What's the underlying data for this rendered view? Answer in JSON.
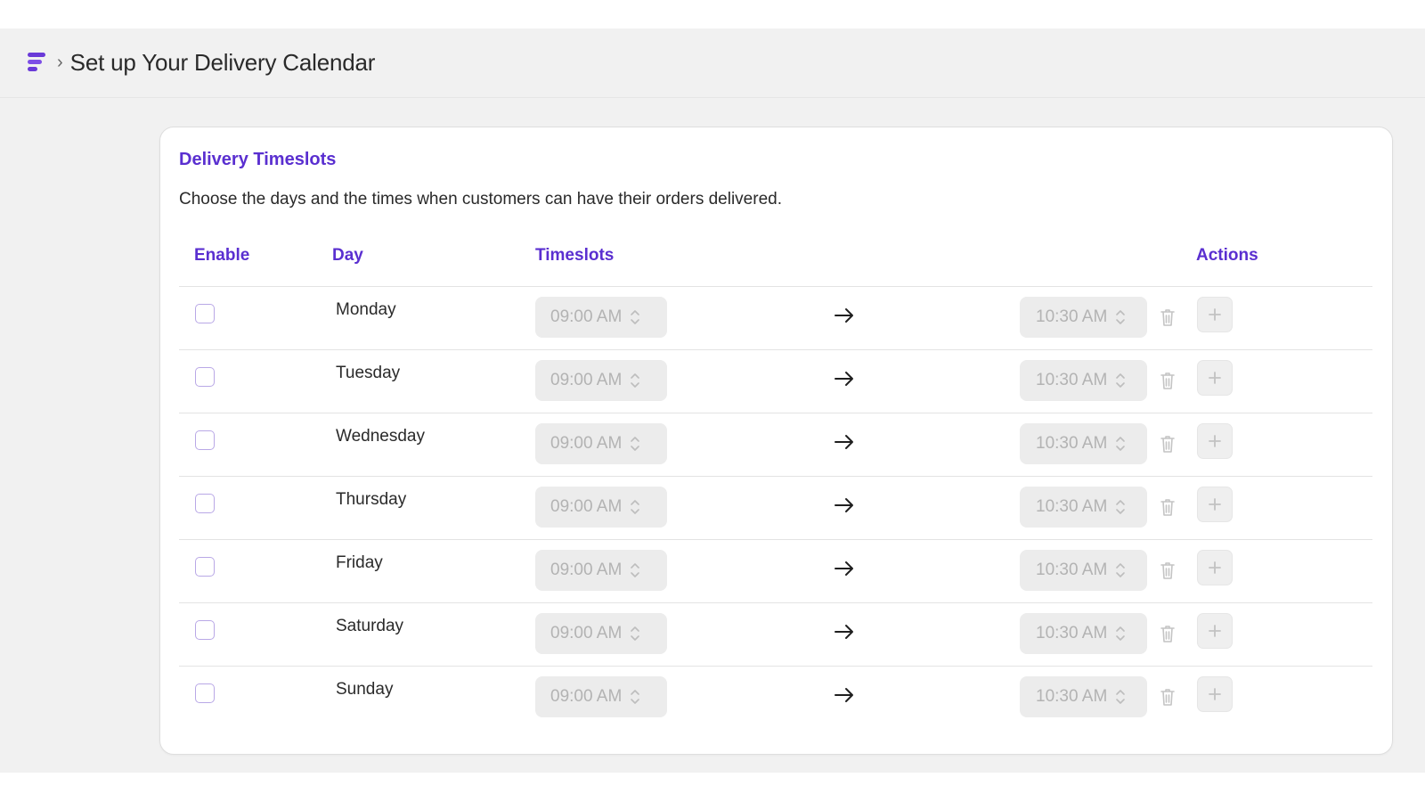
{
  "header": {
    "breadcrumb_separator": "›",
    "title": "Set up Your Delivery Calendar"
  },
  "card": {
    "title": "Delivery Timeslots",
    "description": "Choose the days and the times when customers can have their orders delivered."
  },
  "table": {
    "columns": {
      "enable": "Enable",
      "day": "Day",
      "timeslots": "Timeslots",
      "actions": "Actions"
    },
    "rows": [
      {
        "day": "Monday",
        "enabled": false,
        "start": "09:00 AM",
        "end": "10:30 AM"
      },
      {
        "day": "Tuesday",
        "enabled": false,
        "start": "09:00 AM",
        "end": "10:30 AM"
      },
      {
        "day": "Wednesday",
        "enabled": false,
        "start": "09:00 AM",
        "end": "10:30 AM"
      },
      {
        "day": "Thursday",
        "enabled": false,
        "start": "09:00 AM",
        "end": "10:30 AM"
      },
      {
        "day": "Friday",
        "enabled": false,
        "start": "09:00 AM",
        "end": "10:30 AM"
      },
      {
        "day": "Saturday",
        "enabled": false,
        "start": "09:00 AM",
        "end": "10:30 AM"
      },
      {
        "day": "Sunday",
        "enabled": false,
        "start": "09:00 AM",
        "end": "10:30 AM"
      }
    ]
  },
  "colors": {
    "accent": "#5a2fd0",
    "disabled_text": "#b3b3b3"
  },
  "icons": {
    "logo": "app-logo-icon",
    "arrow": "arrow-right-icon",
    "delete": "trash-icon",
    "add": "plus-icon",
    "spinner": "up-down-chevron-icon"
  }
}
